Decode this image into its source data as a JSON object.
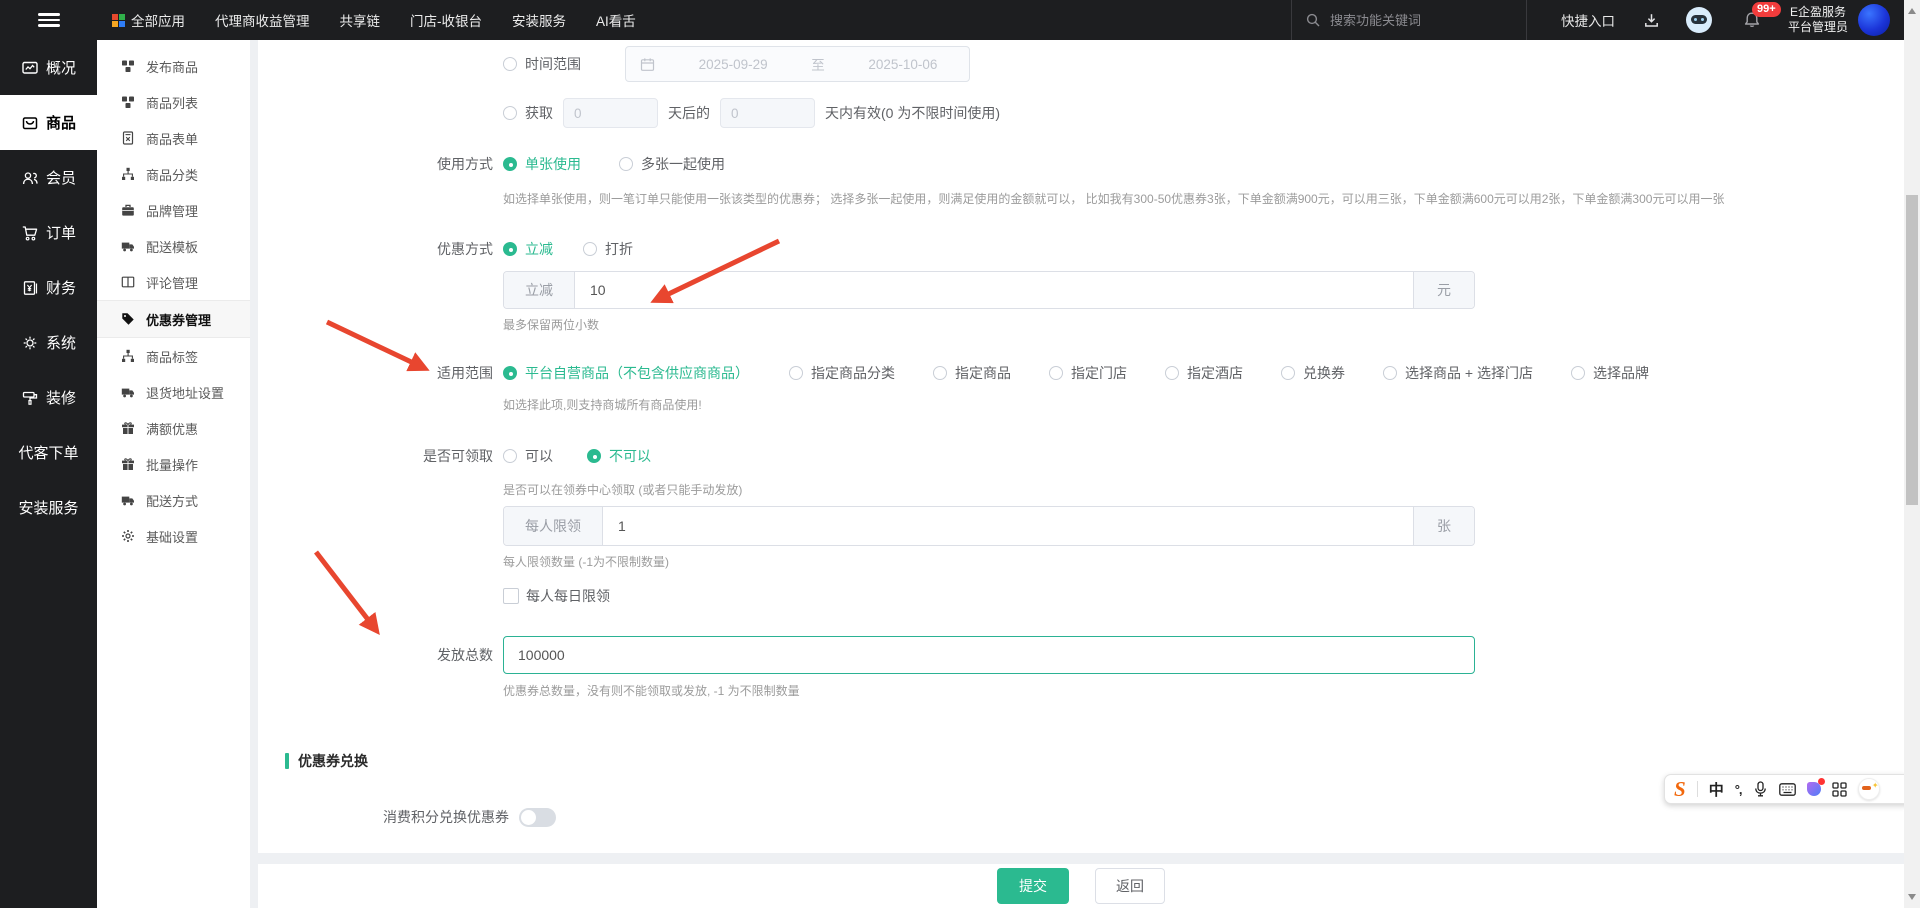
{
  "topbar": {
    "menu": [
      "全部应用",
      "代理商收益管理",
      "共享链",
      "门店-收银台",
      "安装服务",
      "AI看舌"
    ],
    "search_placeholder": "搜索功能关键词",
    "quick_entry": "快捷入口",
    "notice_badge": "99+",
    "user_org": "E企盈服务",
    "user_role": "平台管理员"
  },
  "sidebar_primary": {
    "items": [
      {
        "label": "概况"
      },
      {
        "label": "商品",
        "active": true
      },
      {
        "label": "会员"
      },
      {
        "label": "订单"
      },
      {
        "label": "财务"
      },
      {
        "label": "系统"
      },
      {
        "label": "装修"
      },
      {
        "label": "代客下单"
      },
      {
        "label": "安装服务"
      }
    ]
  },
  "sidebar_secondary": {
    "items": [
      {
        "label": "发布商品"
      },
      {
        "label": "商品列表"
      },
      {
        "label": "商品表单"
      },
      {
        "label": "商品分类"
      },
      {
        "label": "品牌管理"
      },
      {
        "label": "配送模板"
      },
      {
        "label": "评论管理"
      },
      {
        "label": "优惠券管理",
        "active": true
      },
      {
        "label": "商品标签"
      },
      {
        "label": "退货地址设置"
      },
      {
        "label": "满额优惠"
      },
      {
        "label": "批量操作"
      },
      {
        "label": "配送方式"
      },
      {
        "label": "基础设置"
      }
    ]
  },
  "form": {
    "time_row": {
      "label": "时间范围",
      "start": "2025-09-29",
      "sep": "至",
      "end": "2025-10-06"
    },
    "acquire_row": {
      "label": "获取",
      "value1": "0",
      "mid": "天后的",
      "value2": "0",
      "tail": "天内有效(0 为不限时间使用)"
    },
    "usage": {
      "label": "使用方式",
      "options": [
        "单张使用",
        "多张一起使用"
      ],
      "selected": "单张使用",
      "hint": "如选择单张使用，则一笔订单只能使用一张该类型的优惠券； 选择多张一起使用，则满足使用的金额就可以， 比如我有300-50优惠券3张，下单金额满900元，可以用三张，下单金额满600元可以用2张，下单金额满300元可以用一张"
    },
    "discount": {
      "label": "优惠方式",
      "options": [
        "立减",
        "打折"
      ],
      "selected": "立减",
      "prefix": "立减",
      "value": "10",
      "unit": "元",
      "hint": "最多保留两位小数"
    },
    "scope": {
      "label": "适用范围",
      "options": [
        "平台自营商品（不包含供应商商品）",
        "指定商品分类",
        "指定商品",
        "指定门店",
        "指定酒店",
        "兑换券",
        "选择商品 + 选择门店",
        "选择品牌"
      ],
      "selected": "平台自营商品（不包含供应商商品）",
      "hint": "如选择此项,则支持商城所有商品使用!"
    },
    "claim": {
      "label": "是否可领取",
      "options": [
        "可以",
        "不可以"
      ],
      "selected": "不可以",
      "hint": "是否可以在领券中心领取 (或者只能手动发放)",
      "limit_prefix": "每人限领",
      "limit_value": "1",
      "limit_unit": "张",
      "limit_hint": "每人限领数量 (-1为不限制数量)",
      "daily_label": "每人每日限领"
    },
    "total": {
      "label": "发放总数",
      "value": "100000",
      "hint": "优惠券总数量，没有则不能领取或发放, -1 为不限制数量"
    },
    "exchange": {
      "title": "优惠券兑换",
      "toggle_label": "消费积分兑换优惠券",
      "toggle_state": "off"
    },
    "actions": {
      "submit": "提交",
      "back": "返回"
    }
  },
  "ime": {
    "mode": "中",
    "punct": "°,"
  },
  "colors": {
    "accent": "#2bba90",
    "arrow_red": "#e8462f",
    "badge_red": "#f23c3c",
    "topbar_bg": "#1d1e20"
  }
}
